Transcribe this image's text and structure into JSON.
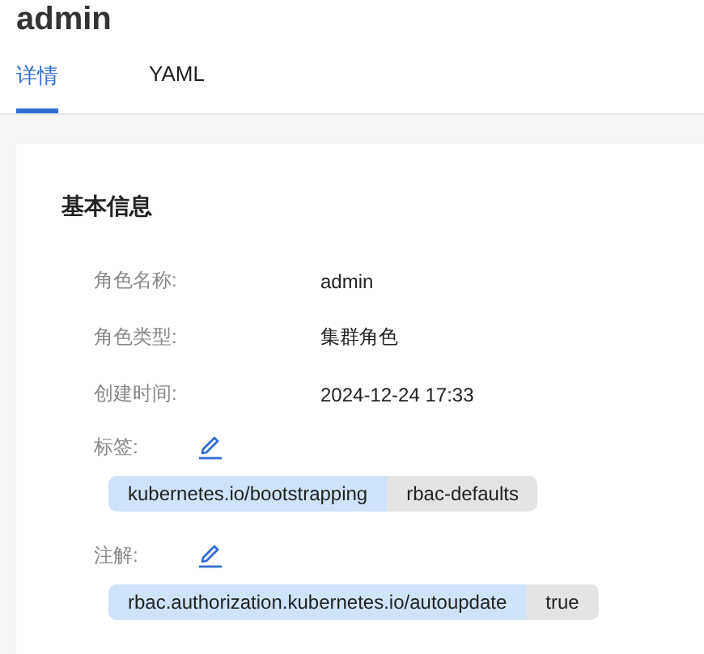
{
  "title": "admin",
  "tabs": [
    {
      "label": "详情",
      "selected": true
    },
    {
      "label": "YAML",
      "selected": false
    }
  ],
  "section": {
    "title": "基本信息",
    "fields": [
      {
        "label": "角色名称:",
        "value": "admin"
      },
      {
        "label": "角色类型:",
        "value": "集群角色"
      },
      {
        "label": "创建时间:",
        "value": "2024-12-24 17:33"
      }
    ],
    "labels": {
      "label": "标签:",
      "pairs": [
        {
          "key": "kubernetes.io/bootstrapping",
          "value": "rbac-defaults"
        }
      ]
    },
    "annotations": {
      "label": "注解:",
      "pairs": [
        {
          "key": "rbac.authorization.kubernetes.io/autoupdate",
          "value": "true"
        }
      ]
    }
  }
}
